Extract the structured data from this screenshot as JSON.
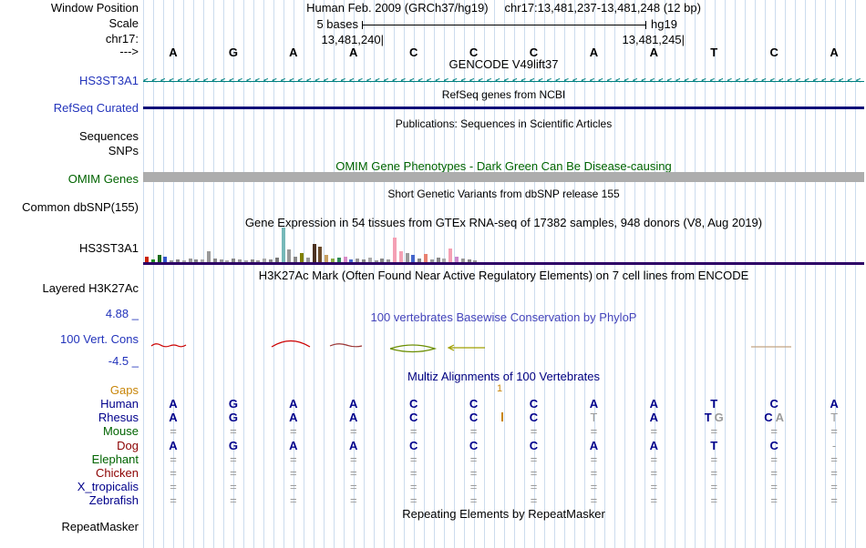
{
  "colors": {
    "label_blue": "#2233bb",
    "navy": "#00008B",
    "muted": "#9a9a9a",
    "orange": "#c8860a",
    "dark_green": "#006400",
    "gencode_teal": "#008080",
    "refseq_navy": "#0c0c78",
    "omim_gray": "#adadad",
    "gtex_purple": "#2d0066",
    "phylop_blue": "#4444bb"
  },
  "header": {
    "window_label": "Window Position",
    "assembly": "Human Feb. 2009 (GRCh37/hg19)",
    "position": "chr17:13,481,237-13,481,248 (12 bp)",
    "scale_label": "Scale",
    "scale_value": "5 bases",
    "genome": "hg19",
    "chrom_label": "chr17:",
    "coord_left": "13,481,240|",
    "coord_right": "13,481,245|",
    "direction_label": "--->"
  },
  "bases": [
    "A",
    "G",
    "A",
    "A",
    "C",
    "C",
    "C",
    "A",
    "A",
    "T",
    "C",
    "A"
  ],
  "tracks": {
    "gencode": {
      "title": "GENCODE V49lift37",
      "label": "HS3ST3A1"
    },
    "refseq": {
      "title": "RefSeq genes from NCBI",
      "label": "RefSeq Curated"
    },
    "publications": {
      "title": "Publications: Sequences in Scientific Articles",
      "label_sequences": "Sequences",
      "label_snps": "SNPs"
    },
    "omim": {
      "title": "OMIM Gene Phenotypes - Dark Green Can Be Disease-causing",
      "label": "OMIM Genes"
    },
    "dbsnp": {
      "title": "Short Genetic Variants from dbSNP release 155",
      "label": "Common dbSNP(155)"
    },
    "gtex": {
      "title": "Gene Expression in 54 tissues from GTEx RNA-seq of 17382 samples, 948 donors (V8, Aug 2019)",
      "label": "HS3ST3A1"
    },
    "h3k27ac": {
      "title": "H3K27Ac Mark (Often Found Near Active Regulatory Elements) on 7 cell lines from ENCODE",
      "label": "Layered H3K27Ac"
    },
    "phylop": {
      "title": "100 vertebrates Basewise Conservation by PhyloP",
      "label": "100 Vert. Cons",
      "max": "4.88 _",
      "min": "-4.5 _"
    },
    "repeatmasker": {
      "title": "Repeating Elements by RepeatMasker",
      "label": "RepeatMasker"
    }
  },
  "chart_data": {
    "type": "bar",
    "title": "Gene Expression in 54 tissues from GTEx RNA-seq of 17382 samples, 948 donors (V8, Aug 2019)",
    "gene": "HS3ST3A1",
    "note": "bar heights are approximate expression levels read from pixels, one bar per GTEx tissue",
    "bars": [
      {
        "v": 6,
        "c": "#cc2200"
      },
      {
        "v": 3,
        "c": "#228B22"
      },
      {
        "v": 8,
        "c": "#1a6b1a"
      },
      {
        "v": 6,
        "c": "#3355cc"
      },
      {
        "v": 2,
        "c": "#999999"
      },
      {
        "v": 3,
        "c": "#888888"
      },
      {
        "v": 2,
        "c": "#aaaaaa"
      },
      {
        "v": 4,
        "c": "#999999"
      },
      {
        "v": 3,
        "c": "#888888"
      },
      {
        "v": 3,
        "c": "#aaaaaa"
      },
      {
        "v": 12,
        "c": "#999999"
      },
      {
        "v": 4,
        "c": "#888888"
      },
      {
        "v": 3,
        "c": "#999999"
      },
      {
        "v": 2,
        "c": "#aaaaaa"
      },
      {
        "v": 4,
        "c": "#888888"
      },
      {
        "v": 3,
        "c": "#999999"
      },
      {
        "v": 2,
        "c": "#aaaaaa"
      },
      {
        "v": 3,
        "c": "#888888"
      },
      {
        "v": 2,
        "c": "#999999"
      },
      {
        "v": 4,
        "c": "#aaaaaa"
      },
      {
        "v": 3,
        "c": "#888888"
      },
      {
        "v": 5,
        "c": "#777777"
      },
      {
        "v": 38,
        "c": "#76b8b8"
      },
      {
        "v": 14,
        "c": "#999999"
      },
      {
        "v": 6,
        "c": "#888888"
      },
      {
        "v": 10,
        "c": "#808000"
      },
      {
        "v": 5,
        "c": "#999999"
      },
      {
        "v": 20,
        "c": "#4a3020"
      },
      {
        "v": 17,
        "c": "#6a4a2a"
      },
      {
        "v": 8,
        "c": "#c8a060"
      },
      {
        "v": 4,
        "c": "#88aa44"
      },
      {
        "v": 5,
        "c": "#2e8b57"
      },
      {
        "v": 6,
        "c": "#d88cc8"
      },
      {
        "v": 3,
        "c": "#4466cc"
      },
      {
        "v": 4,
        "c": "#999999"
      },
      {
        "v": 3,
        "c": "#888888"
      },
      {
        "v": 5,
        "c": "#aaaaaa"
      },
      {
        "v": 2,
        "c": "#999999"
      },
      {
        "v": 4,
        "c": "#888888"
      },
      {
        "v": 3,
        "c": "#999999"
      },
      {
        "v": 27,
        "c": "#f4a0b4"
      },
      {
        "v": 12,
        "c": "#f4a0b4"
      },
      {
        "v": 10,
        "c": "#999999"
      },
      {
        "v": 8,
        "c": "#4466cc"
      },
      {
        "v": 4,
        "c": "#888888"
      },
      {
        "v": 9,
        "c": "#e88070"
      },
      {
        "v": 3,
        "c": "#999999"
      },
      {
        "v": 5,
        "c": "#888888"
      },
      {
        "v": 4,
        "c": "#aaaaaa"
      },
      {
        "v": 15,
        "c": "#f4a0b4"
      },
      {
        "v": 6,
        "c": "#cc88cc"
      },
      {
        "v": 4,
        "c": "#999999"
      },
      {
        "v": 3,
        "c": "#888888"
      },
      {
        "v": 2,
        "c": "#999999"
      }
    ]
  },
  "alignment": {
    "title": "Multiz Alignments of 100 Vertebrates",
    "gaps_label": "Gaps",
    "insert_marker": "1",
    "rows": [
      {
        "label": "Human",
        "color": "#00008B",
        "cells": [
          "A",
          "G",
          "A",
          "A",
          "C",
          "C",
          "C",
          "A",
          "A",
          "T",
          "C",
          "A"
        ]
      },
      {
        "label": "Rhesus",
        "color": "#00008B",
        "cells": [
          "A",
          "G",
          "A",
          "A",
          "C",
          "C",
          "C",
          {
            "t": "T",
            "muted": true
          },
          "A",
          {
            "t": "T",
            "t2": "G"
          },
          {
            "t": "C",
            "t2": "A"
          },
          {
            "t": "T",
            "muted": true
          }
        ]
      },
      {
        "label": "Mouse",
        "color": "#006400",
        "cells": [
          "=",
          "=",
          "=",
          "=",
          "=",
          "=",
          "=",
          "=",
          "=",
          "=",
          "=",
          "="
        ]
      },
      {
        "label": "Dog",
        "color": "#8B0000",
        "cells": [
          "A",
          "G",
          "A",
          "A",
          "C",
          "C",
          "C",
          "A",
          "A",
          "T",
          "C",
          {
            "t": "-",
            "muted": true
          }
        ]
      },
      {
        "label": "Elephant",
        "color": "#006400",
        "cells": [
          "=",
          "=",
          "=",
          "=",
          "=",
          "=",
          "=",
          "=",
          "=",
          "=",
          "=",
          "="
        ]
      },
      {
        "label": "Chicken",
        "color": "#8B0000",
        "cells": [
          "=",
          "=",
          "=",
          "=",
          "=",
          "=",
          "=",
          "=",
          "=",
          "=",
          "=",
          "="
        ]
      },
      {
        "label": "X_tropicalis",
        "color": "#00008B",
        "cells": [
          "=",
          "=",
          "=",
          "=",
          "=",
          "=",
          "=",
          "=",
          "=",
          "=",
          "=",
          "="
        ]
      },
      {
        "label": "Zebrafish",
        "color": "#00008B",
        "cells": [
          "=",
          "=",
          "=",
          "=",
          "=",
          "=",
          "=",
          "=",
          "=",
          "=",
          "=",
          "="
        ]
      }
    ]
  }
}
